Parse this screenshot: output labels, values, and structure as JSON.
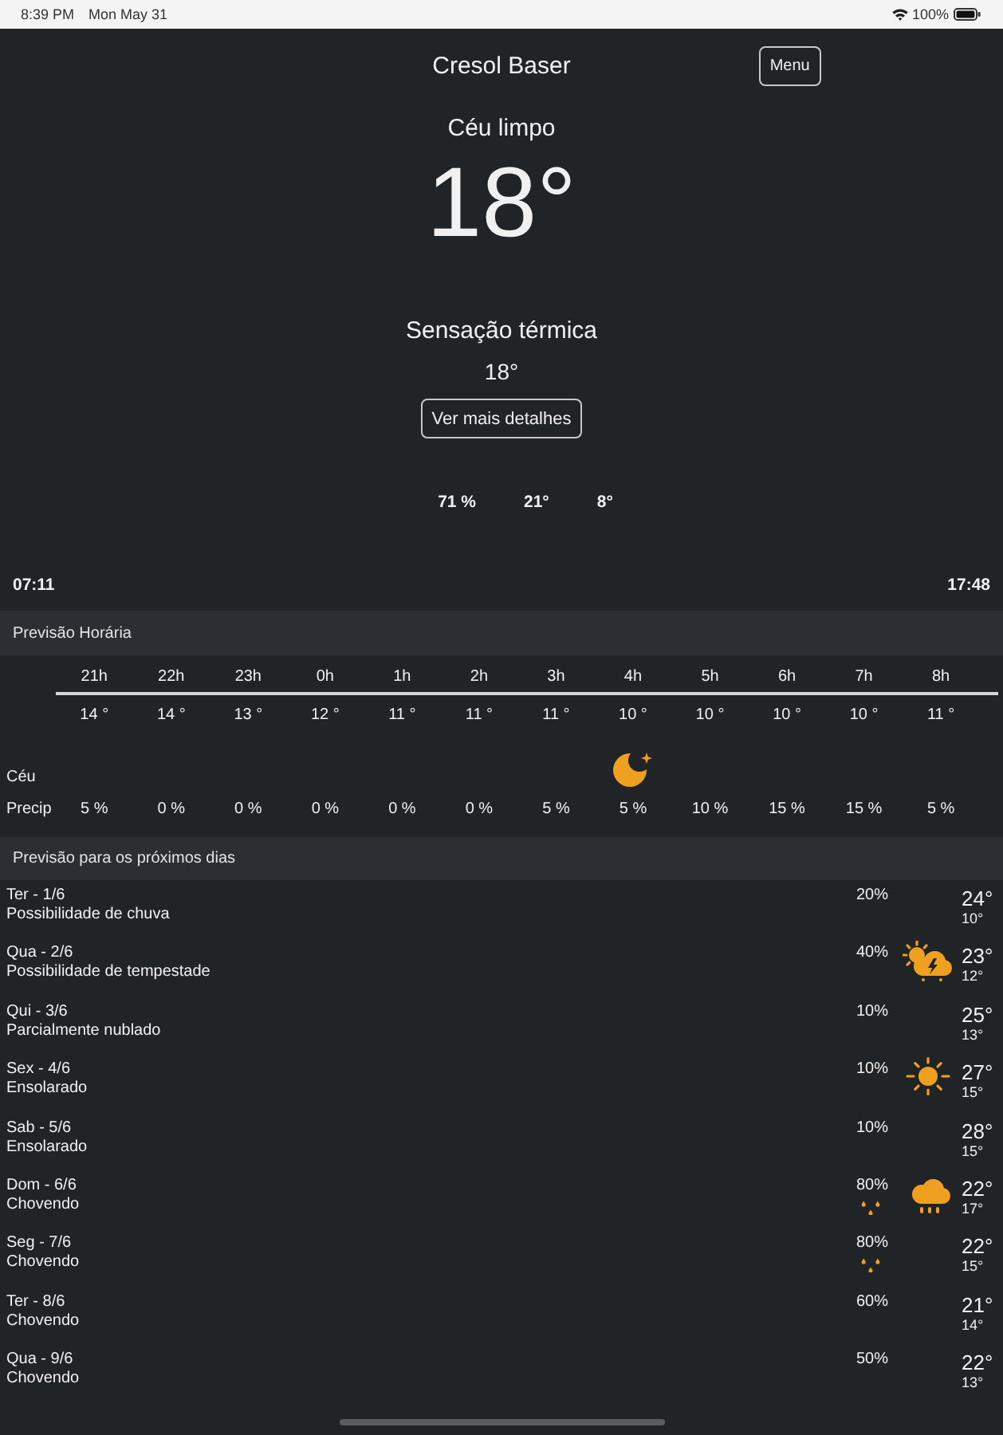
{
  "status_bar": {
    "time": "8:39 PM",
    "date": "Mon May 31",
    "battery": "100%"
  },
  "header": {
    "title": "Cresol Baser",
    "menu_button": "Menu"
  },
  "current": {
    "condition": "Céu limpo",
    "temperature": "18°",
    "feels_like_label": "Sensação térmica",
    "feels_like": "18°",
    "details_button": "Ver mais detalhes",
    "stats": [
      "71 %",
      "21°",
      "8°"
    ],
    "sunrise": "07:11",
    "sunset": "17:48"
  },
  "hourly": {
    "title": "Previsão Horária",
    "sky_label": "Céu",
    "precip_label": "Precip",
    "hours": [
      {
        "hour": "21h",
        "temp": "14 °",
        "precip": "5 %",
        "kind": "plain"
      },
      {
        "hour": "22h",
        "temp": "14 °",
        "precip": "0 %",
        "kind": "plain"
      },
      {
        "hour": "23h",
        "temp": "13 °",
        "precip": "0 %",
        "kind": "plain"
      },
      {
        "hour": "0h",
        "temp": "12 °",
        "precip": "0 %",
        "kind": "plain"
      },
      {
        "hour": "1h",
        "temp": "11 °",
        "precip": "0 %",
        "kind": "plain"
      },
      {
        "hour": "2h",
        "temp": "11 °",
        "precip": "0 %",
        "kind": "plain"
      },
      {
        "hour": "3h",
        "temp": "11 °",
        "precip": "5 %",
        "kind": "plain"
      },
      {
        "hour": "4h",
        "temp": "10 °",
        "precip": "5 %",
        "kind": "moon"
      },
      {
        "hour": "5h",
        "temp": "10 °",
        "precip": "10 %",
        "kind": "plain"
      },
      {
        "hour": "6h",
        "temp": "10 °",
        "precip": "15 %",
        "kind": "plain"
      },
      {
        "hour": "7h",
        "temp": "10 °",
        "precip": "15 %",
        "kind": "plain"
      },
      {
        "hour": "8h",
        "temp": "11 °",
        "precip": "5 %",
        "kind": "plain"
      }
    ]
  },
  "daily": {
    "title": "Previsão para os próximos dias",
    "days": [
      {
        "day": "Ter - 1/6",
        "summary": "Possibilidade de chuva",
        "precip": "20%",
        "raindrops": false,
        "kind": "plain",
        "high": "24°",
        "low": "10°"
      },
      {
        "day": "Qua - 2/6",
        "summary": "Possibilidade de tempestade",
        "precip": "40%",
        "raindrops": false,
        "kind": "thunderstorm",
        "high": "23°",
        "low": "12°"
      },
      {
        "day": "Qui - 3/6",
        "summary": "Parcialmente nublado",
        "precip": "10%",
        "raindrops": false,
        "kind": "plain",
        "high": "25°",
        "low": "13°"
      },
      {
        "day": "Sex - 4/6",
        "summary": "Ensolarado",
        "precip": "10%",
        "raindrops": false,
        "kind": "sunny",
        "high": "27°",
        "low": "15°"
      },
      {
        "day": "Sab - 5/6",
        "summary": "Ensolarado",
        "precip": "10%",
        "raindrops": false,
        "kind": "plain",
        "high": "28°",
        "low": "15°"
      },
      {
        "day": "Dom - 6/6",
        "summary": "Chovendo",
        "precip": "80%",
        "raindrops": true,
        "kind": "rain",
        "high": "22°",
        "low": "17°"
      },
      {
        "day": "Seg - 7/6",
        "summary": "Chovendo",
        "precip": "80%",
        "raindrops": true,
        "kind": "plain",
        "high": "22°",
        "low": "15°"
      },
      {
        "day": "Ter - 8/6",
        "summary": "Chovendo",
        "precip": "60%",
        "raindrops": false,
        "kind": "plain",
        "high": "21°",
        "low": "14°"
      },
      {
        "day": "Qua - 9/6",
        "summary": "Chovendo",
        "precip": "50%",
        "raindrops": false,
        "kind": "plain",
        "high": "22°",
        "low": "13°"
      }
    ]
  }
}
